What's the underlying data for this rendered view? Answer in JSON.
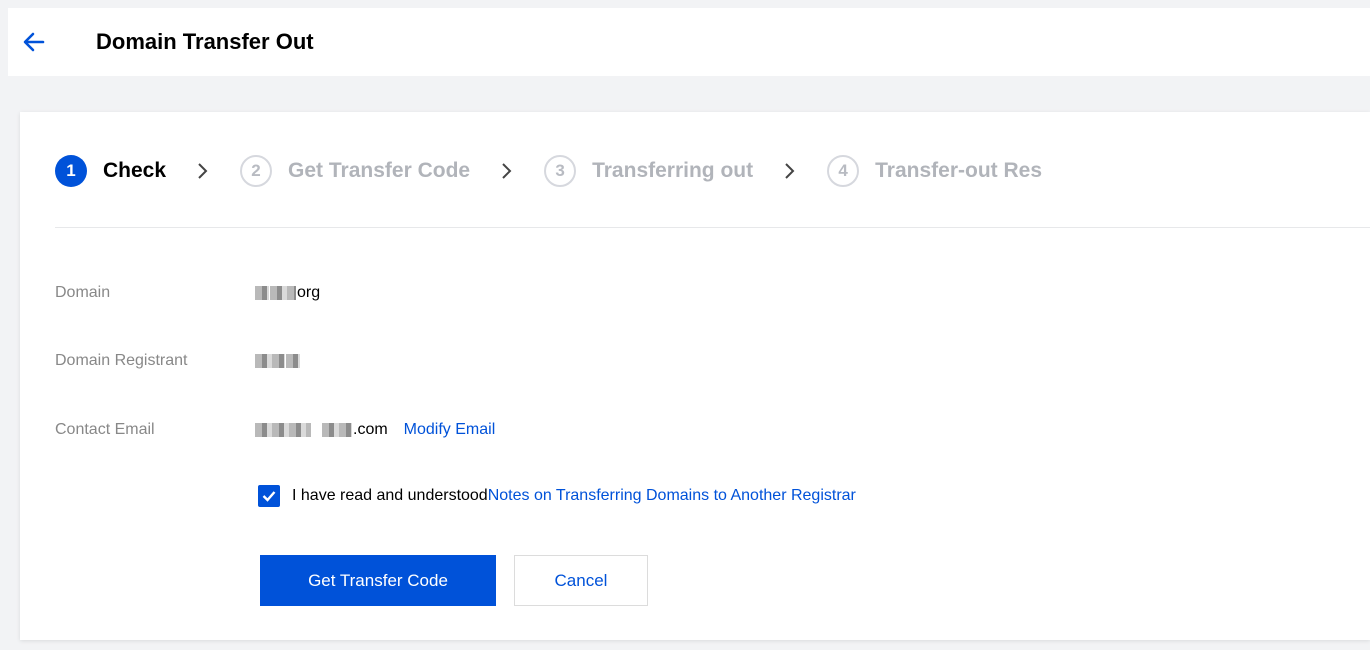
{
  "header": {
    "back_icon": "arrow-left-icon",
    "title": "Domain Transfer Out"
  },
  "steps": [
    {
      "number": "1",
      "label": "Check",
      "state": "active"
    },
    {
      "number": "2",
      "label": "Get Transfer Code",
      "state": "inactive"
    },
    {
      "number": "3",
      "label": "Transferring out",
      "state": "inactive"
    },
    {
      "number": "4",
      "label": "Transfer-out Res",
      "state": "inactive"
    }
  ],
  "form": {
    "domain_label": "Domain",
    "domain_value_suffix": "org",
    "registrant_label": "Domain Registrant",
    "email_label": "Contact Email",
    "email_value_suffix": ".com",
    "modify_email": "Modify Email"
  },
  "agreement": {
    "checked": true,
    "text": "I have read and understood",
    "link": "Notes on Transferring Domains to Another Registrar"
  },
  "buttons": {
    "get_code": "Get Transfer Code",
    "cancel": "Cancel"
  },
  "colors": {
    "accent": "#0052d9",
    "muted_label": "#888888",
    "inactive_step": "#b1b4ba"
  }
}
